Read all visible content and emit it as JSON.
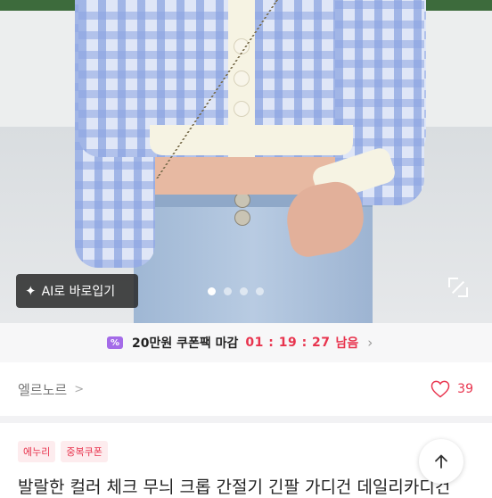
{
  "hero": {
    "ai_button_label": "AI로 바로입기",
    "carousel_dots": 4,
    "carousel_active_index": 0
  },
  "coupon_bar": {
    "text": "20만원 쿠폰팩 마감",
    "timer": "01 : 19 : 27",
    "timer_suffix": "남음",
    "icon_glyph": "%"
  },
  "shop": {
    "name": "엘르노르",
    "like_count": "39"
  },
  "product": {
    "badges": [
      "에누리",
      "중복쿠폰"
    ],
    "title": "발랄한 컬러 체크 무늬 크롭 간절기 긴팔 가디건 데일리카디건"
  },
  "colors": {
    "accent": "#e8344e",
    "coupon_icon": "#a46be8"
  }
}
